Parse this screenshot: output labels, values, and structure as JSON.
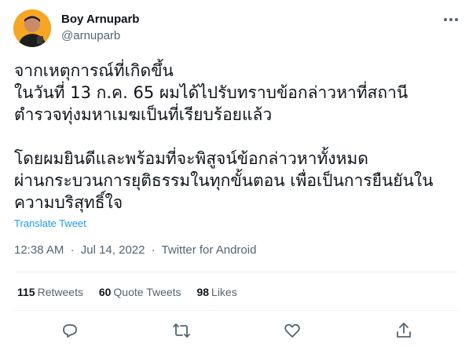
{
  "author": {
    "display_name": "Boy Arnuparb",
    "handle": "@arnuparb"
  },
  "icons": {
    "more": "more-horizontal-icon",
    "reply": "reply-icon",
    "retweet": "retweet-icon",
    "like": "like-icon",
    "share": "share-icon"
  },
  "tweet": {
    "lines": [
      "จากเหตุการณ์ที่เกิดขึ้น",
      "ในวันที่ 13 ก.ค. 65 ผมได้ไปรับทราบข้อกล่าวหาที่สถานี",
      "ตำรวจทุ่งมหาเมฆเป็นที่เรียบร้อยแล้ว",
      "โดยผมยินดีและพร้อมที่จะพิสูจน์ข้อกล่าวหาทั้งหมด",
      "ผ่านกระบวนการยุติธรรมในทุกขั้นตอน เพื่อเป็นการยืนยันใน",
      "ความบริสุทธิ์ใจ"
    ],
    "translate_label": "Translate Tweet"
  },
  "meta": {
    "time": "12:38 AM",
    "separator": "·",
    "date": "Jul 14, 2022",
    "source": "Twitter for Android"
  },
  "stats": {
    "retweets_count": "115",
    "retweets_label": "Retweets",
    "quote_count": "60",
    "quote_label": "Quote Tweets",
    "likes_count": "98",
    "likes_label": "Likes"
  },
  "colors": {
    "text": "#0f1419",
    "secondary": "#536471",
    "accent": "#1d9bf0",
    "divider": "#eff3f4"
  }
}
